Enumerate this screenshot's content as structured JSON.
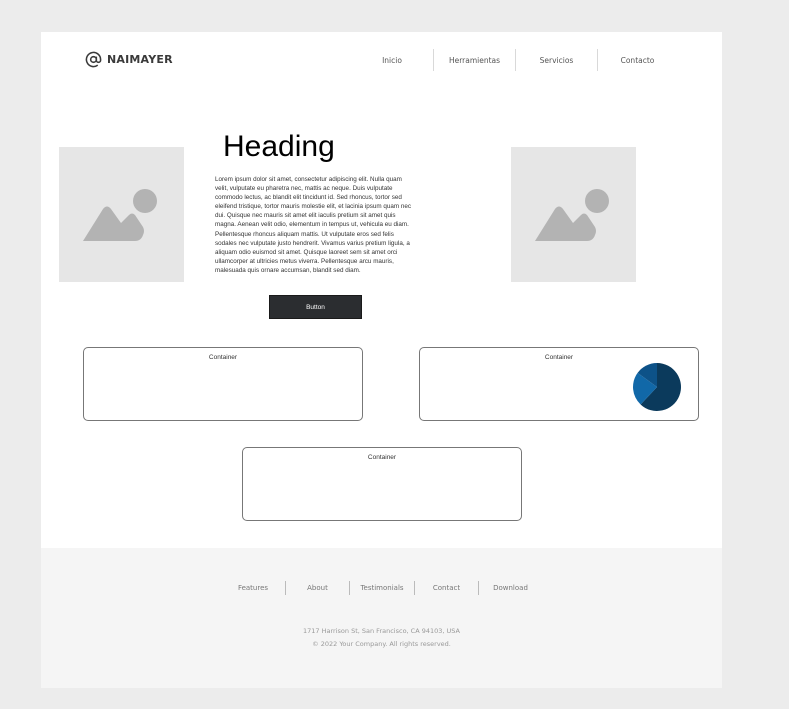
{
  "brand": {
    "name": "NAIMAYER",
    "icon": "at-sign-icon"
  },
  "nav": {
    "items": [
      "Inicio",
      "Herramientas",
      "Servicios",
      "Contacto"
    ]
  },
  "hero": {
    "heading": "Heading",
    "body": "Lorem ipsum dolor sit amet, consectetur adipiscing elit. Nulla quam velit, vulputate eu pharetra nec, mattis ac neque. Duis vulputate commodo lectus, ac blandit elit tincidunt id. Sed rhoncus, tortor sed eleifend tristique, tortor mauris molestie elit, et lacinia ipsum quam nec dui. Quisque nec mauris sit amet elit iaculis pretium sit amet quis magna. Aenean velit odio, elementum in tempus ut, vehicula eu diam. Pellentesque rhoncus aliquam mattis. Ut vulputate eros sed felis sodales nec vulputate justo hendrerit. Vivamus varius pretium ligula, a aliquam odio euismod sit amet. Quisque laoreet sem sit amet orci ullamcorper at ultricies metus viverra. Pellentesque arcu mauris, malesuada quis ornare accumsan, blandit sed diam.",
    "button_label": "Button",
    "image_icon": "image-placeholder-icon"
  },
  "containers": [
    {
      "label": "Container"
    },
    {
      "label": "Container"
    },
    {
      "label": "Container"
    }
  ],
  "pie": {
    "slices": [
      0.62,
      0.23,
      0.15
    ],
    "colors": [
      "#0b3a5c",
      "#1168a8",
      "#0d5288"
    ]
  },
  "footer": {
    "links": [
      "Features",
      "About",
      "Testimonials",
      "Contact",
      "Download"
    ],
    "address": "1717 Harrison St, San Francisco, CA 94103, USA",
    "copyright": "© 2022 Your Company.  All rights reserved."
  },
  "colors": {
    "button_bg": "#2b2d30",
    "placeholder_bg": "#e6e6e6",
    "placeholder_icon": "#b3b3b3",
    "footer_bg": "#f5f5f5"
  }
}
